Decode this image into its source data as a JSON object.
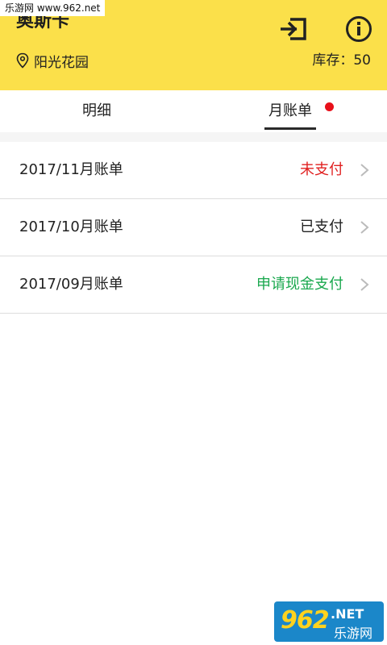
{
  "watermark": {
    "top_text": "乐游网 www.962.net",
    "logo": "962",
    "net": ".NET",
    "cn": "乐游网"
  },
  "header": {
    "store_name": "奥斯卡",
    "location": "阳光花园",
    "stock_label": "库存：50",
    "exit_icon": "exit-icon",
    "info_icon": "info-icon",
    "pin_icon": "location-pin-icon",
    "background": "#fbe04a"
  },
  "tabs": [
    {
      "label": "明细",
      "active": false
    },
    {
      "label": "月账单",
      "active": true,
      "has_badge_dot": true
    }
  ],
  "bills": [
    {
      "month": "2017/11月账单",
      "status": "未支付",
      "status_color": "#e02020"
    },
    {
      "month": "2017/10月账单",
      "status": "已支付",
      "status_color": "#222222"
    },
    {
      "month": "2017/09月账单",
      "status": "申请现金支付",
      "status_color": "#1aa84e"
    }
  ],
  "colors": {
    "badge_dot": "#e8101a",
    "divider": "#dddddd"
  }
}
